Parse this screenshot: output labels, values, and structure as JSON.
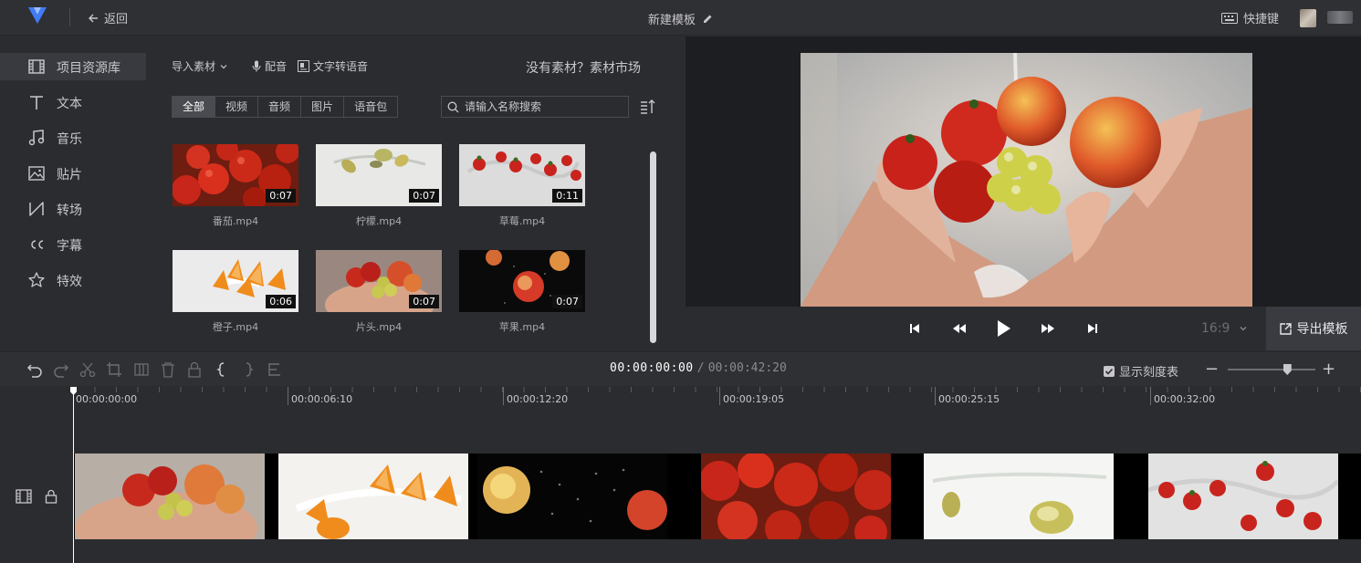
{
  "app": {
    "back_label": "返回",
    "doc_title": "新建模板",
    "shortcut_label": "快捷键"
  },
  "leftnav": {
    "items": [
      {
        "label": "项目资源库",
        "icon": "film-icon",
        "active": true
      },
      {
        "label": "文本",
        "icon": "text-icon"
      },
      {
        "label": "音乐",
        "icon": "music-icon"
      },
      {
        "label": "贴片",
        "icon": "image-icon"
      },
      {
        "label": "转场",
        "icon": "transition-icon"
      },
      {
        "label": "字幕",
        "icon": "caption-icon"
      },
      {
        "label": "特效",
        "icon": "star-icon"
      }
    ]
  },
  "resources": {
    "import_label": "导入素材",
    "dub_label": "配音",
    "tts_label": "文字转语音",
    "market_label": "没有素材？素材市场",
    "filters": [
      "全部",
      "视频",
      "音频",
      "图片",
      "语音包"
    ],
    "active_filter": "全部",
    "search_placeholder": "请输入名称搜索",
    "items": [
      {
        "name": "番茄.mp4",
        "duration": "0:07",
        "theme": "tomato"
      },
      {
        "name": "柠檬.mp4",
        "duration": "0:07",
        "theme": "lemon"
      },
      {
        "name": "草莓.mp4",
        "duration": "0:11",
        "theme": "strawberry"
      },
      {
        "name": "橙子.mp4",
        "duration": "0:06",
        "theme": "orange"
      },
      {
        "name": "片头.mp4",
        "duration": "0:07",
        "theme": "hands"
      },
      {
        "name": "苹果.mp4",
        "duration": "0:07",
        "theme": "apple"
      }
    ]
  },
  "player": {
    "aspect_ratio": "16:9",
    "export_label": "导出模板"
  },
  "timeline": {
    "current_time": "00:00:00:00",
    "separator": "/",
    "total_time": "00:00:42:20",
    "show_ruler_label": "显示刻度表",
    "show_ruler_checked": true,
    "zoom_level": 0.68,
    "ticks": [
      "00:00:00:00",
      "00:00:06:10",
      "00:00:12:20",
      "00:00:19:05",
      "00:00:25:15",
      "00:00:32:00"
    ],
    "clips": [
      {
        "theme": "hands"
      },
      {
        "theme": "orange"
      },
      {
        "theme": "apple"
      },
      {
        "theme": "tomato"
      },
      {
        "theme": "lemon"
      },
      {
        "theme": "strawberry"
      }
    ]
  },
  "colors": {
    "background": "#2b2c30",
    "titlebar": "#2f3034",
    "preview_bg": "#1d1e21",
    "accent_logo": "#3f7cf5"
  }
}
